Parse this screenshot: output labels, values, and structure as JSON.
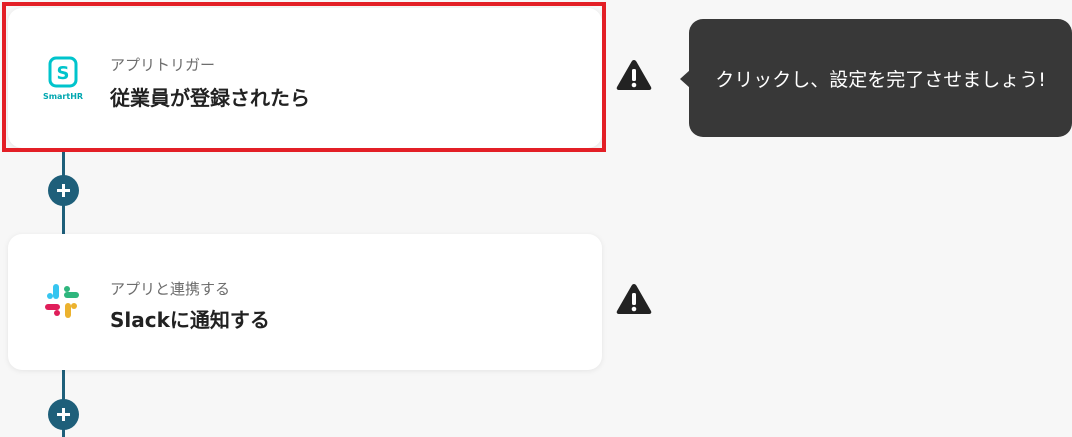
{
  "flow": {
    "steps": [
      {
        "app": "SmartHR",
        "icon": "smarthr-logo-icon",
        "kind_label": "アプリトリガー",
        "title": "従業員が登録されたら",
        "status_icon": "warning-icon",
        "selected": true
      },
      {
        "app": "Slack",
        "icon": "slack-logo-icon",
        "kind_label": "アプリと連携する",
        "title": "Slackに通知する",
        "status_icon": "warning-icon",
        "selected": false
      }
    ],
    "add_step_icon": "plus-icon"
  },
  "tooltip": {
    "text": "クリックし、設定を完了させましょう!"
  },
  "colors": {
    "background": "#f7f7f7",
    "connector": "#1e5f7a",
    "selection": "#e31f26",
    "tooltip_bg": "#383838",
    "smarthr_brand": "#00c4cc",
    "warning": "#222222"
  }
}
